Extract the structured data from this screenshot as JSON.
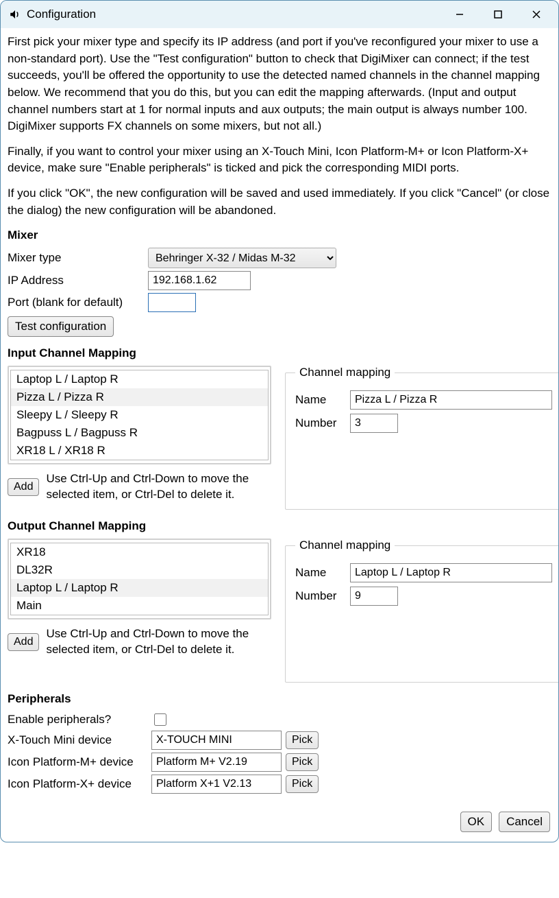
{
  "window": {
    "title": "Configuration"
  },
  "intro": {
    "p1": "First pick your mixer type and specify its IP address (and port if you've reconfigured your mixer to use a non-standard port). Use the \"Test configuration\" button to check that DigiMixer can connect; if the test succeeds, you'll be offered the opportunity to use the detected named channels in the channel mapping below. We recommend that you do this, but you can edit the mapping afterwards. (Input and output channel numbers start at 1 for normal inputs and aux outputs; the main output is always number 100. DigiMixer supports FX channels on some mixers, but not all.)",
    "p2": "Finally, if you want to control your mixer using an X-Touch Mini, Icon Platform-M+ or Icon Platform-X+ device, make sure \"Enable peripherals\" is ticked and pick the corresponding MIDI ports.",
    "p3": "If you click \"OK\", the new configuration will be saved and used immediately. If you click \"Cancel\" (or close the dialog) the new configuration will be abandoned."
  },
  "sections": {
    "mixer": "Mixer",
    "input_mapping": "Input Channel Mapping",
    "output_mapping": "Output Channel Mapping",
    "peripherals": "Peripherals"
  },
  "mixer": {
    "type_label": "Mixer type",
    "type_value": "Behringer X-32 / Midas M-32",
    "ip_label": "IP Address",
    "ip_value": "192.168.1.62",
    "port_label": "Port (blank for default)",
    "port_value": "",
    "test_btn": "Test configuration"
  },
  "mapping": {
    "fieldset_legend": "Channel mapping",
    "name_label": "Name",
    "number_label": "Number",
    "add_btn": "Add",
    "hint": "Use Ctrl-Up and Ctrl-Down to move the selected item, or Ctrl-Del to delete it."
  },
  "input_list": {
    "items": [
      "Laptop L / Laptop R",
      "Pizza L / Pizza R",
      "Sleepy L / Sleepy R",
      "Bagpuss L / Bagpuss R",
      "XR18 L / XR18 R"
    ],
    "selected_index": 1,
    "edit_name": "Pizza L / Pizza R",
    "edit_number": "3"
  },
  "output_list": {
    "items": [
      "XR18",
      "DL32R",
      "Laptop L / Laptop R",
      "Main"
    ],
    "selected_index": 2,
    "edit_name": "Laptop L / Laptop R",
    "edit_number": "9"
  },
  "peripherals": {
    "enable_label": "Enable peripherals?",
    "enable_checked": false,
    "xtouch_label": "X-Touch Mini device",
    "xtouch_value": "X-TOUCH MINI",
    "iconm_label": "Icon Platform-M+ device",
    "iconm_value": "Platform M+ V2.19",
    "iconx_label": "Icon Platform-X+ device",
    "iconx_value": "Platform X+1 V2.13",
    "pick_btn": "Pick"
  },
  "buttons": {
    "ok": "OK",
    "cancel": "Cancel"
  }
}
